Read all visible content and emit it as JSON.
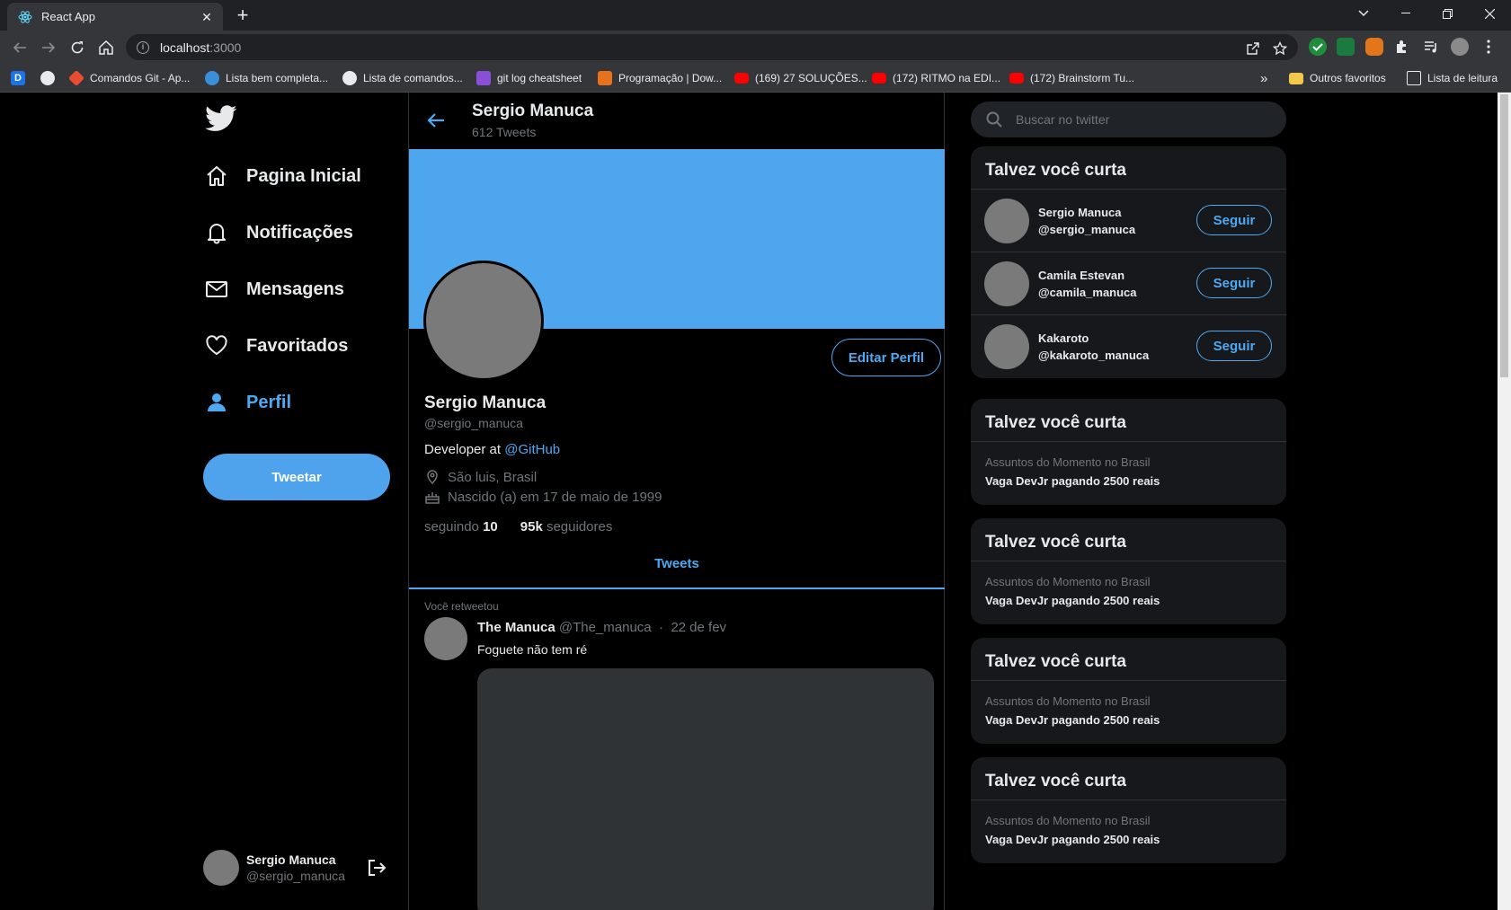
{
  "browser": {
    "tab_title": "React App",
    "url_host": "localhost",
    "url_port": ":3000",
    "bookmarks": [
      {
        "label": "",
        "color": "#1a73e8"
      },
      {
        "label": "",
        "color": "#e8eaed"
      },
      {
        "label": "Comandos Git - Ap...",
        "color": "#e84d31"
      },
      {
        "label": "Lista bem completa...",
        "color": "#3b8fd8"
      },
      {
        "label": "Lista de comandos...",
        "color": "#e8eaed"
      },
      {
        "label": "git log cheatsheet",
        "color": "#8a4fd8"
      },
      {
        "label": "Programação | Dow...",
        "color": "#e8721c"
      },
      {
        "label": "(169) 27 SOLUÇÕES...",
        "color": "#ff0000"
      },
      {
        "label": "(172) RITMO na EDI...",
        "color": "#ff0000"
      },
      {
        "label": "(172) Brainstorm Tu...",
        "color": "#ff0000"
      }
    ],
    "more_bookmarks": "»",
    "other_favorites": "Outros favoritos",
    "reading_list": "Lista de leitura"
  },
  "sidebar": {
    "items": [
      {
        "label": "Pagina Inicial",
        "icon": "home-icon"
      },
      {
        "label": "Notificações",
        "icon": "bell-icon"
      },
      {
        "label": "Mensagens",
        "icon": "mail-icon"
      },
      {
        "label": "Favoritados",
        "icon": "heart-icon"
      },
      {
        "label": "Perfil",
        "icon": "user-icon"
      }
    ],
    "tweet_button": "Tweetar",
    "user": {
      "name": "Sergio Manuca",
      "handle": "@sergio_manuca"
    }
  },
  "profile": {
    "header_name": "Sergio Manuca",
    "header_count": "612 Tweets",
    "edit_button": "Editar Perfil",
    "name": "Sergio Manuca",
    "handle": "@sergio_manuca",
    "bio_text": "Developer at ",
    "bio_link": "@GitHub",
    "location": "São luis, Brasil",
    "birth": "Nascido (a) em 17 de maio de 1999",
    "following_label": "seguindo",
    "following_count": "10",
    "followers_count": "95k",
    "followers_label": "seguidores",
    "tab": "Tweets"
  },
  "tweet": {
    "retweeted_label": "Você retweetou",
    "author": "The Manuca",
    "handle": "@The_manuca",
    "separator": "·",
    "date": "22 de fev",
    "text": "Foguete não tem ré"
  },
  "right": {
    "search_placeholder": "Buscar no twitter",
    "suggestions_title": "Talvez você curta",
    "follow_label": "Seguir",
    "suggestions": [
      {
        "name": "Sergio Manuca",
        "handle": "@sergio_manuca"
      },
      {
        "name": "Camila Estevan",
        "handle": "@camila_manuca"
      },
      {
        "name": "Kakaroto",
        "handle": "@kakaroto_manuca"
      }
    ],
    "trend_cards": [
      {
        "title": "Talvez você curta",
        "category": "Assuntos do Momento no Brasil",
        "topic": "Vaga DevJr pagando 2500 reais"
      },
      {
        "title": "Talvez você curta",
        "category": "Assuntos do Momento no Brasil",
        "topic": "Vaga DevJr pagando 2500 reais"
      },
      {
        "title": "Talvez você curta",
        "category": "Assuntos do Momento no Brasil",
        "topic": "Vaga DevJr pagando 2500 reais"
      },
      {
        "title": "Talvez você curta",
        "category": "Assuntos do Momento no Brasil",
        "topic": "Vaga DevJr pagando 2500 reais"
      }
    ]
  },
  "colors": {
    "accent": "#4ea9f3",
    "banner": "#4ea6ee",
    "card": "#16181c"
  }
}
